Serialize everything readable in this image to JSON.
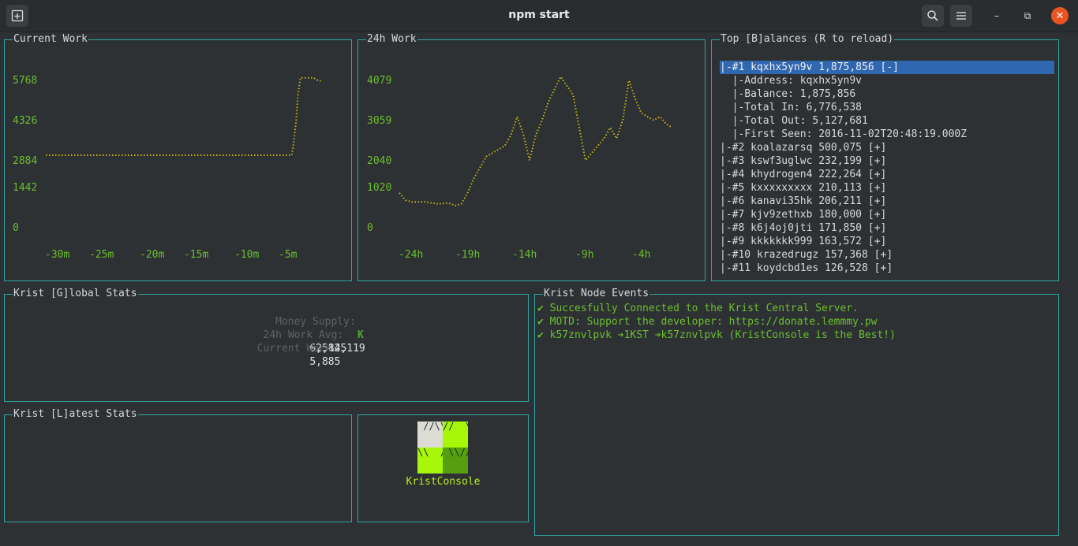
{
  "window": {
    "title": "npm start",
    "new_tab_icon": "new-tab-icon",
    "search_icon": "search-icon",
    "menu_icon": "hamburger-menu-icon",
    "minimize_glyph": "–",
    "maximize_glyph": "⧉",
    "close_glyph": "✕"
  },
  "current_work": {
    "title": "Current Work",
    "chart_data": {
      "type": "line",
      "y_ticks": [
        "5768",
        "4326",
        "2884",
        "1442",
        "0"
      ],
      "x_ticks": [
        "-30m",
        "-25m",
        "-20m",
        "-15m",
        "-10m",
        "-5m"
      ],
      "ylim": [
        0,
        5768
      ],
      "x": [
        -32.5,
        -32,
        -31,
        -30,
        -29,
        -28,
        -27,
        -26,
        -25,
        -24,
        -23,
        -22,
        -21,
        -20,
        -19,
        -18,
        -17,
        -16,
        -15,
        -14,
        -13,
        -12,
        -11,
        -10,
        -9,
        -8,
        -7,
        -6,
        -5,
        -4.5,
        -4,
        -3.8,
        -3.5,
        -3.3,
        -3,
        -2.5,
        -2,
        -1.5,
        -1,
        -0.5
      ],
      "values": [
        2884,
        2884,
        2884,
        2884,
        2884,
        2884,
        2884,
        2884,
        2884,
        2884,
        2884,
        2884,
        2884,
        2884,
        2884,
        2884,
        2884,
        2884,
        2884,
        2884,
        2884,
        2884,
        2884,
        2884,
        2884,
        2884,
        2884,
        2884,
        2884,
        2884,
        2884,
        3300,
        4200,
        5200,
        5900,
        5900,
        5900,
        5900,
        5800,
        5768
      ],
      "color": "#c9b01a"
    }
  },
  "day_work": {
    "title": "24h Work",
    "chart_data": {
      "type": "line",
      "y_ticks": [
        "4079",
        "3059",
        "2040",
        "1020",
        "0"
      ],
      "x_ticks": [
        "-24h",
        "-19h",
        "-14h",
        "-9h",
        "-4h"
      ],
      "ylim": [
        0,
        4079
      ],
      "x": [
        -24,
        -23.5,
        -23,
        -22,
        -21,
        -20,
        -19.5,
        -19,
        -18.5,
        -18,
        -17,
        -16,
        -15.5,
        -15,
        -14.5,
        -14,
        -13.5,
        -13,
        -12.5,
        -12,
        -11,
        -10,
        -9.5,
        -9,
        -8.5,
        -8,
        -7.5,
        -7,
        -6.5,
        -6,
        -5.5,
        -5,
        -4.5,
        -4,
        -3.5,
        -3,
        -2.5,
        -2
      ],
      "values": [
        1000,
        800,
        750,
        760,
        700,
        720,
        650,
        700,
        1000,
        1400,
        2000,
        2200,
        2300,
        2600,
        3100,
        2600,
        1900,
        2600,
        3000,
        3500,
        4200,
        3700,
        2800,
        1900,
        2100,
        2300,
        2500,
        2800,
        2500,
        3000,
        4100,
        3600,
        3200,
        3100,
        3000,
        3100,
        2900,
        2800
      ],
      "color": "#c9b01a"
    }
  },
  "balances": {
    "title": "Top [B]alances (R to reload)",
    "rows": [
      "|-#1 kqxhx5yn9v 1,875,856 [-]",
      "  |-Address: kqxhx5yn9v",
      "  |-Balance: 1,875,856",
      "  |-Total In: 6,776,538",
      "  |-Total Out: 5,127,681",
      "  |-First Seen: 2016-11-02T20:48:19.000Z",
      "|-#2 koalazarsq 500,075 [+]",
      "|-#3 kswf3uglwc 232,199 [+]",
      "|-#4 khydrogen4 222,264 [+]",
      "|-#5 kxxxxxxxxx 210,113 [+]",
      "|-#6 kanavi35hk 206,211 [+]",
      "|-#7 kjv9zethxb 180,000 [+]",
      "|-#8 k6j4oj0jti 171,850 [+]",
      "|-#9 kkkkkkk999 163,572 [+]",
      "|-#10 krazedrugz 157,368 [+]",
      "|-#11 koydcbd1es 126,528 [+]"
    ]
  },
  "global_stats": {
    "title": "Krist [G]lobal Stats",
    "money_supply_label": "Money Supply:",
    "money_supply_symbol": "K",
    "money_supply_value": "6,582,119",
    "work_avg_label": "24h Work Avg:",
    "work_avg_value": "~2,145",
    "current_work_label": "Current Work:",
    "current_work_value": "5,885"
  },
  "latest_stats": {
    "title": "Krist [L]atest Stats"
  },
  "logo": {
    "name": "KristConsole",
    "q1": " //\\\\",
    "q2": "//  \\\\",
    "q3": "\\\\  //",
    "q4": " \\\\//"
  },
  "events": {
    "title": "Krist Node Events",
    "items": [
      "✔ Succesfully Connected to the Krist Central Server.",
      "✔ MOTD: Support the developer: https://donate.lemmmy.pw",
      "✔ k57znvlpvk ➔1KST ➔k57znvlpvk (KristConsole is the Best!)"
    ]
  }
}
